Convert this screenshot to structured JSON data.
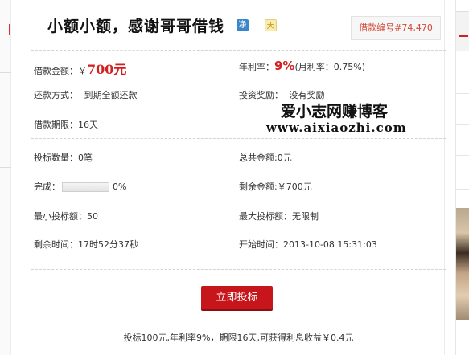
{
  "loan": {
    "title": "小额小额，感谢哥哥借钱",
    "badge_jing": "净",
    "badge_tian": "天",
    "loan_no": "借款编号#74,470"
  },
  "details": {
    "amount_label": "借款金额：",
    "amount_currency": "￥",
    "amount_value": "700元",
    "rate_label": "年利率：",
    "rate_value": "9%",
    "monthly_rate": "(月利率：0.75%)",
    "repay_label": "还款方式：",
    "repay_value": "到期全额还款",
    "reward_label": "投资奖励：",
    "reward_value": "没有奖励",
    "term_label": "借款期限：",
    "term_value": "16天"
  },
  "watermark": {
    "line1": "爱小志网赚博客",
    "line2": "www.aixiaozhi.com"
  },
  "stats": {
    "bid_count": "投标数量：0笔",
    "total_amount": "总共金额:0元",
    "complete_label": "完成：",
    "complete_value": "0%",
    "progress_fraction": 0,
    "remaining_amount": "剩余金额:￥700元",
    "min_bid": "最小投标额：50",
    "max_bid": "最大投标额：无限制",
    "time_left": "剩余时间：17时52分37秒",
    "start_time": "开始时间：2013-10-08 15:31:03"
  },
  "action": {
    "bid_button": "立即投标",
    "bid_info": "投标100元,年利率9%，期限16天,可获得利息收益￥0.4元"
  },
  "colors": {
    "accent_red": "#c6161b",
    "text_red": "#d21f1f",
    "loan_no_color": "#d24a36"
  }
}
